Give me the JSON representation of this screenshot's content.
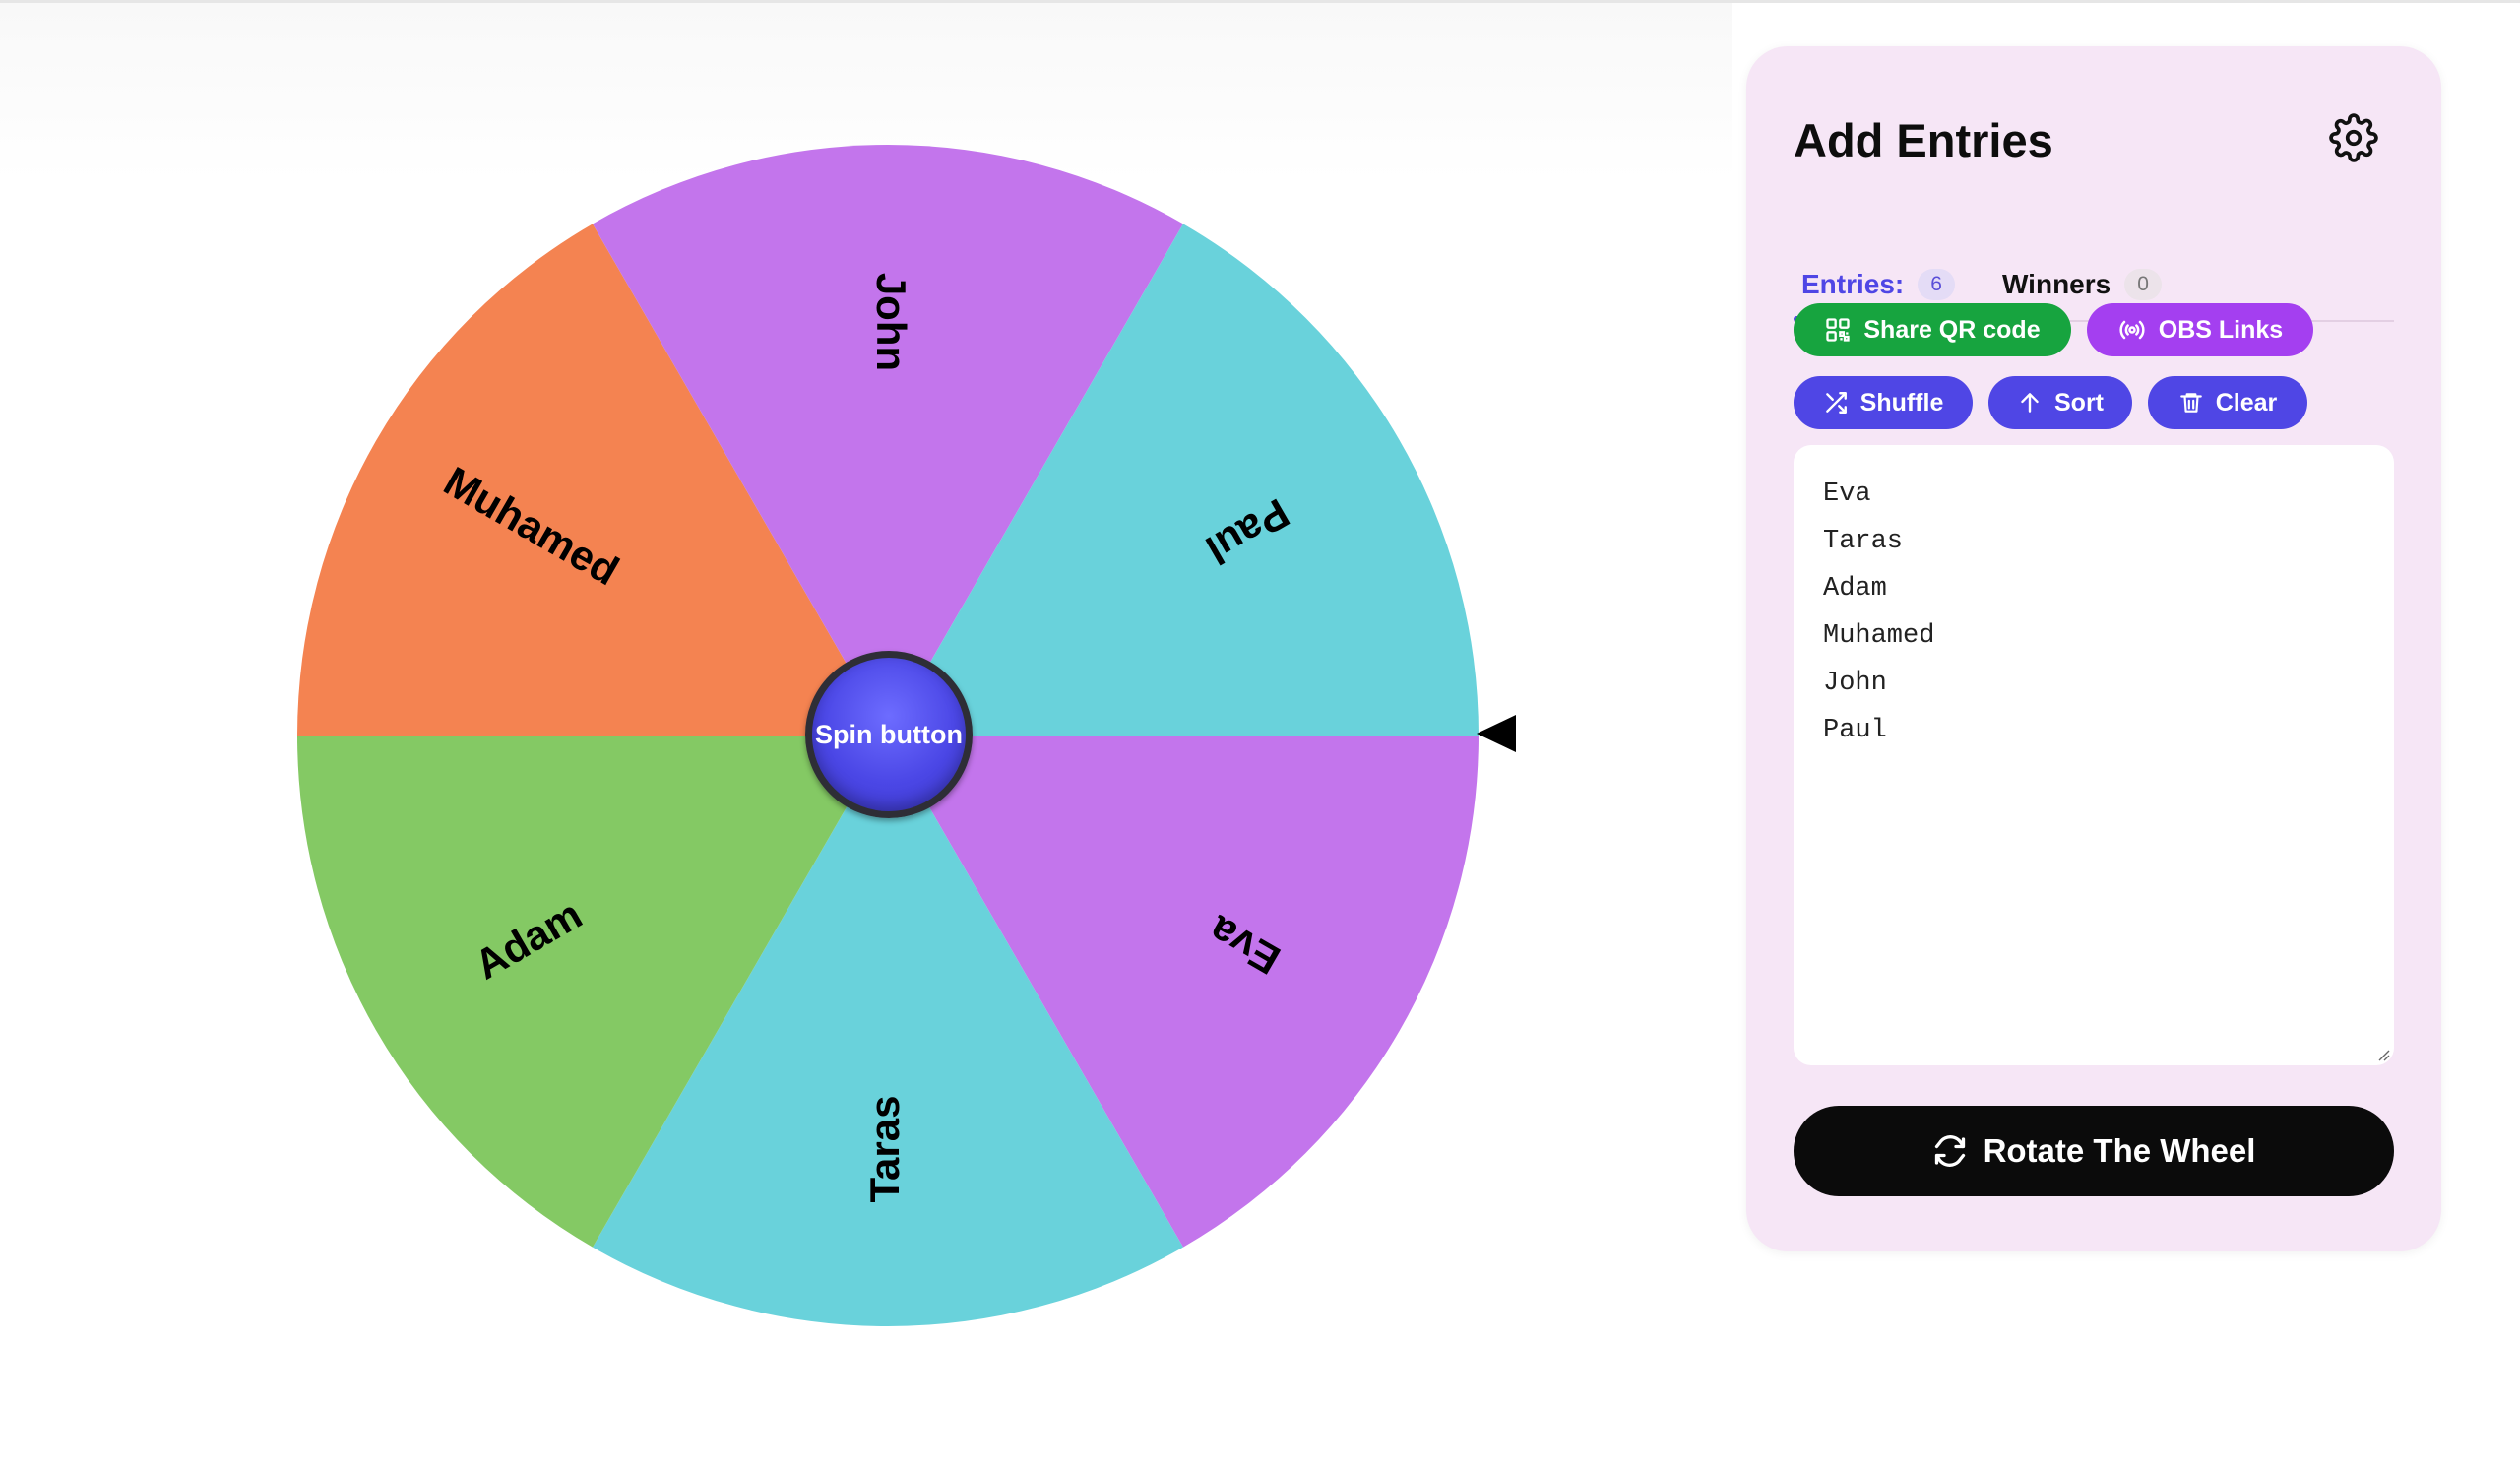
{
  "wheel": {
    "segments": [
      {
        "name": "Eva",
        "color": "#c375ec"
      },
      {
        "name": "Taras",
        "color": "#69d2db"
      },
      {
        "name": "Adam",
        "color": "#84c964"
      },
      {
        "name": "Muhamed",
        "color": "#f48351"
      },
      {
        "name": "John",
        "color": "#c375ec"
      },
      {
        "name": "Paul",
        "color": "#69d2db"
      }
    ],
    "spin_label": "Spin button"
  },
  "panel": {
    "title": "Add Entries",
    "tabs": [
      {
        "label": "Entries:",
        "count": "6",
        "active": true
      },
      {
        "label": "Winners",
        "count": "0",
        "active": false
      }
    ],
    "buttons": {
      "share_qr": "Share QR code",
      "obs_links": "OBS Links",
      "shuffle": "Shuffle",
      "sort": "Sort",
      "clear": "Clear"
    },
    "entries": [
      "Eva",
      "Taras",
      "Adam",
      "Muhamed",
      "John",
      "Paul"
    ],
    "rotate_label": "Rotate The Wheel"
  }
}
